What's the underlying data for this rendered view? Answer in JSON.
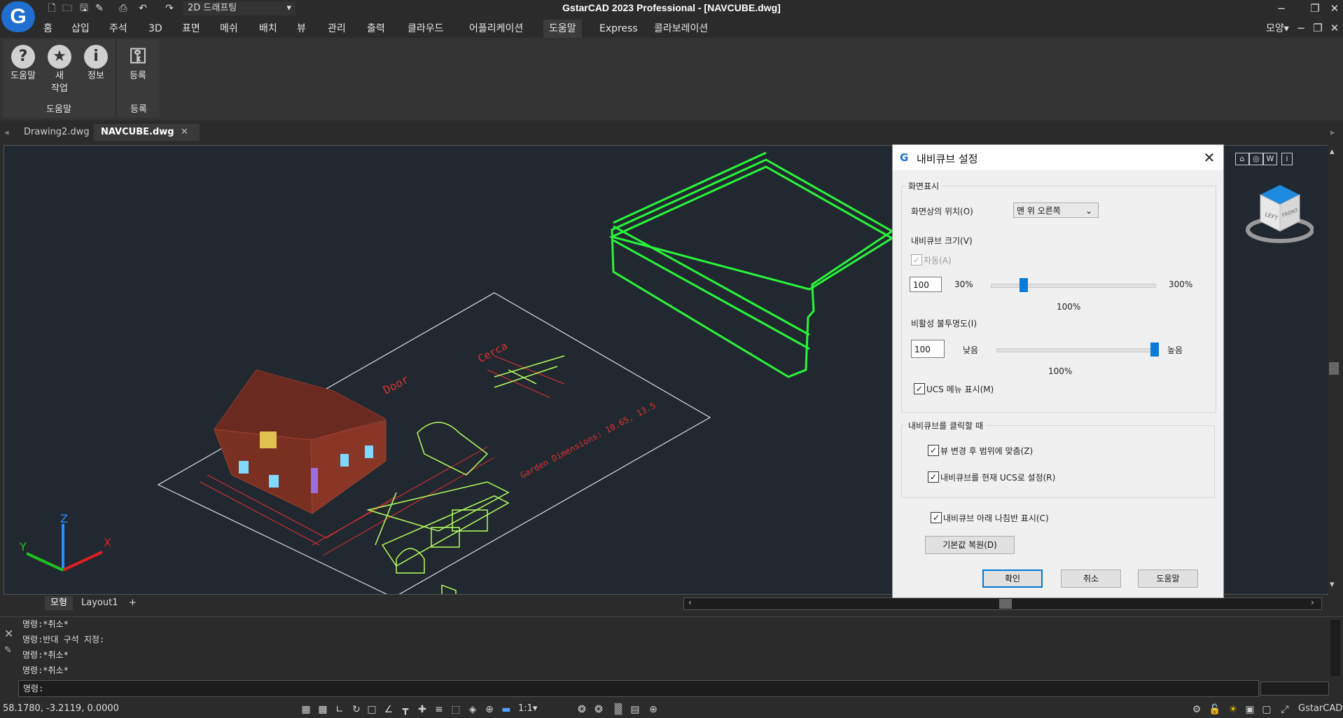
{
  "app": {
    "title": "GstarCAD 2023 Professional - [NAVCUBE.dwg]",
    "logo_letter": "G",
    "workspace": "2D 드래프팅",
    "right_label": "모양",
    "brand_color": "#1e6fd0"
  },
  "quick_access": {
    "icons": [
      "new-file-icon",
      "open-folder-icon",
      "save-icon",
      "save-as-icon",
      "print-icon",
      "undo-icon",
      "redo-icon"
    ]
  },
  "menu": [
    "홈",
    "삽입",
    "주석",
    "3D",
    "표면",
    "메쉬",
    "배치",
    "뷰",
    "관리",
    "출력",
    "클라우드",
    "어플리케이션",
    "도움말",
    "Express",
    "콜라보레이션"
  ],
  "menu_active": "도움말",
  "ribbon": {
    "help_group": {
      "title": "도움말",
      "buttons": [
        {
          "label": "도움말",
          "icon": "question-icon"
        },
        {
          "label": "새\n작업",
          "icon": "star-icon"
        },
        {
          "label": "정보",
          "icon": "info-icon"
        }
      ]
    },
    "register_group": {
      "title": "등록",
      "buttons": [
        {
          "label": "등록",
          "icon": "key-icon"
        }
      ]
    }
  },
  "doc_tabs": [
    {
      "label": "Drawing2.dwg",
      "active": false
    },
    {
      "label": "NAVCUBE.dwg",
      "active": true
    }
  ],
  "drawing_texts": {
    "door": "Door",
    "cerca": "Cerca",
    "garden": "Garden Dimensions: 10.65, 13.5",
    "axis_x": "X",
    "axis_y": "Y",
    "axis_z": "Z"
  },
  "navcube": {
    "face_left": "LEFT",
    "face_front": "FRONT",
    "toolbar_icons": [
      "home-icon",
      "orbit-icon",
      "wcs-icon",
      "info-icon"
    ],
    "wcs_label": "W"
  },
  "model_tabs": [
    "모형",
    "Layout1",
    "+"
  ],
  "command": {
    "history": [
      "명령:*취소*",
      "명령:반대 구석 지정:",
      "명령:*취소*",
      "명령:*취소*"
    ],
    "prompt": "명령:"
  },
  "status": {
    "coords": "58.1780, -3.2119, 0.0000",
    "scale": "1:1",
    "app_name": "GstarCAD"
  },
  "dialog": {
    "title": "내비큐브 설정",
    "display_group": "화면표시",
    "position_label": "화면상의 위치(O)",
    "position_value": "맨 위 오른쪽",
    "size_label": "내비큐브 크기(V)",
    "auto_label": "자동(A)",
    "auto_checked": true,
    "size_value": "100",
    "size_min": "30%",
    "size_max": "300%",
    "size_current": "100%",
    "size_fraction": 0.2,
    "opacity_label": "비활성 불투명도(I)",
    "opacity_value": "100",
    "opacity_low": "낮음",
    "opacity_high": "높음",
    "opacity_current": "100%",
    "opacity_fraction": 1.0,
    "ucs_menu_label": "UCS 메뉴 표시(M)",
    "ucs_menu_checked": true,
    "click_group": "내비큐브를 클릭할 때",
    "fit_label": "뷰 변경 후 범위에 맞춤(Z)",
    "fit_checked": true,
    "set_ucs_label": "내비큐브를 현재 UCS로 설정(R)",
    "set_ucs_checked": true,
    "compass_label": "내비큐브 아래 나침반 표시(C)",
    "compass_checked": true,
    "restore_button": "기본값 복원(D)",
    "ok_button": "확인",
    "cancel_button": "취소",
    "help_button": "도움말"
  }
}
